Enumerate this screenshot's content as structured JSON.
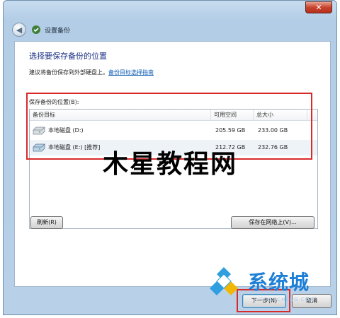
{
  "window": {
    "close_glyph": "✕",
    "title": "设置备份"
  },
  "page": {
    "heading": "选择要保存备份的位置",
    "subline_text": "建议将备份保存到外部硬盘上。",
    "subline_link": "备份目标选择指南",
    "group_label": "保存备份的位置(B):"
  },
  "table": {
    "columns": [
      "备份目标",
      "可用空间",
      "总大小"
    ],
    "rows": [
      {
        "name": "本地磁盘 (D:)",
        "free": "205.59 GB",
        "total": "233.00 GB",
        "icon": "hard-drive-icon"
      },
      {
        "name": "本地磁盘 (E:) [推荐]",
        "free": "212.72 GB",
        "total": "232.76 GB",
        "icon": "hard-drive-icon"
      }
    ]
  },
  "buttons": {
    "refresh": "刷新(R)",
    "save_network": "保存在网络上(V)...",
    "next": "下一步(N)",
    "cancel": "取消"
  },
  "watermarks": {
    "main": "木星教程网",
    "logo_text": "系统城",
    "url": "XITONGCHENG.COM"
  },
  "colors": {
    "heading": "#1e3287",
    "link": "#0b5bb5",
    "highlight_box": "#d92a2a",
    "logo_blue": "#1d7fd6"
  }
}
